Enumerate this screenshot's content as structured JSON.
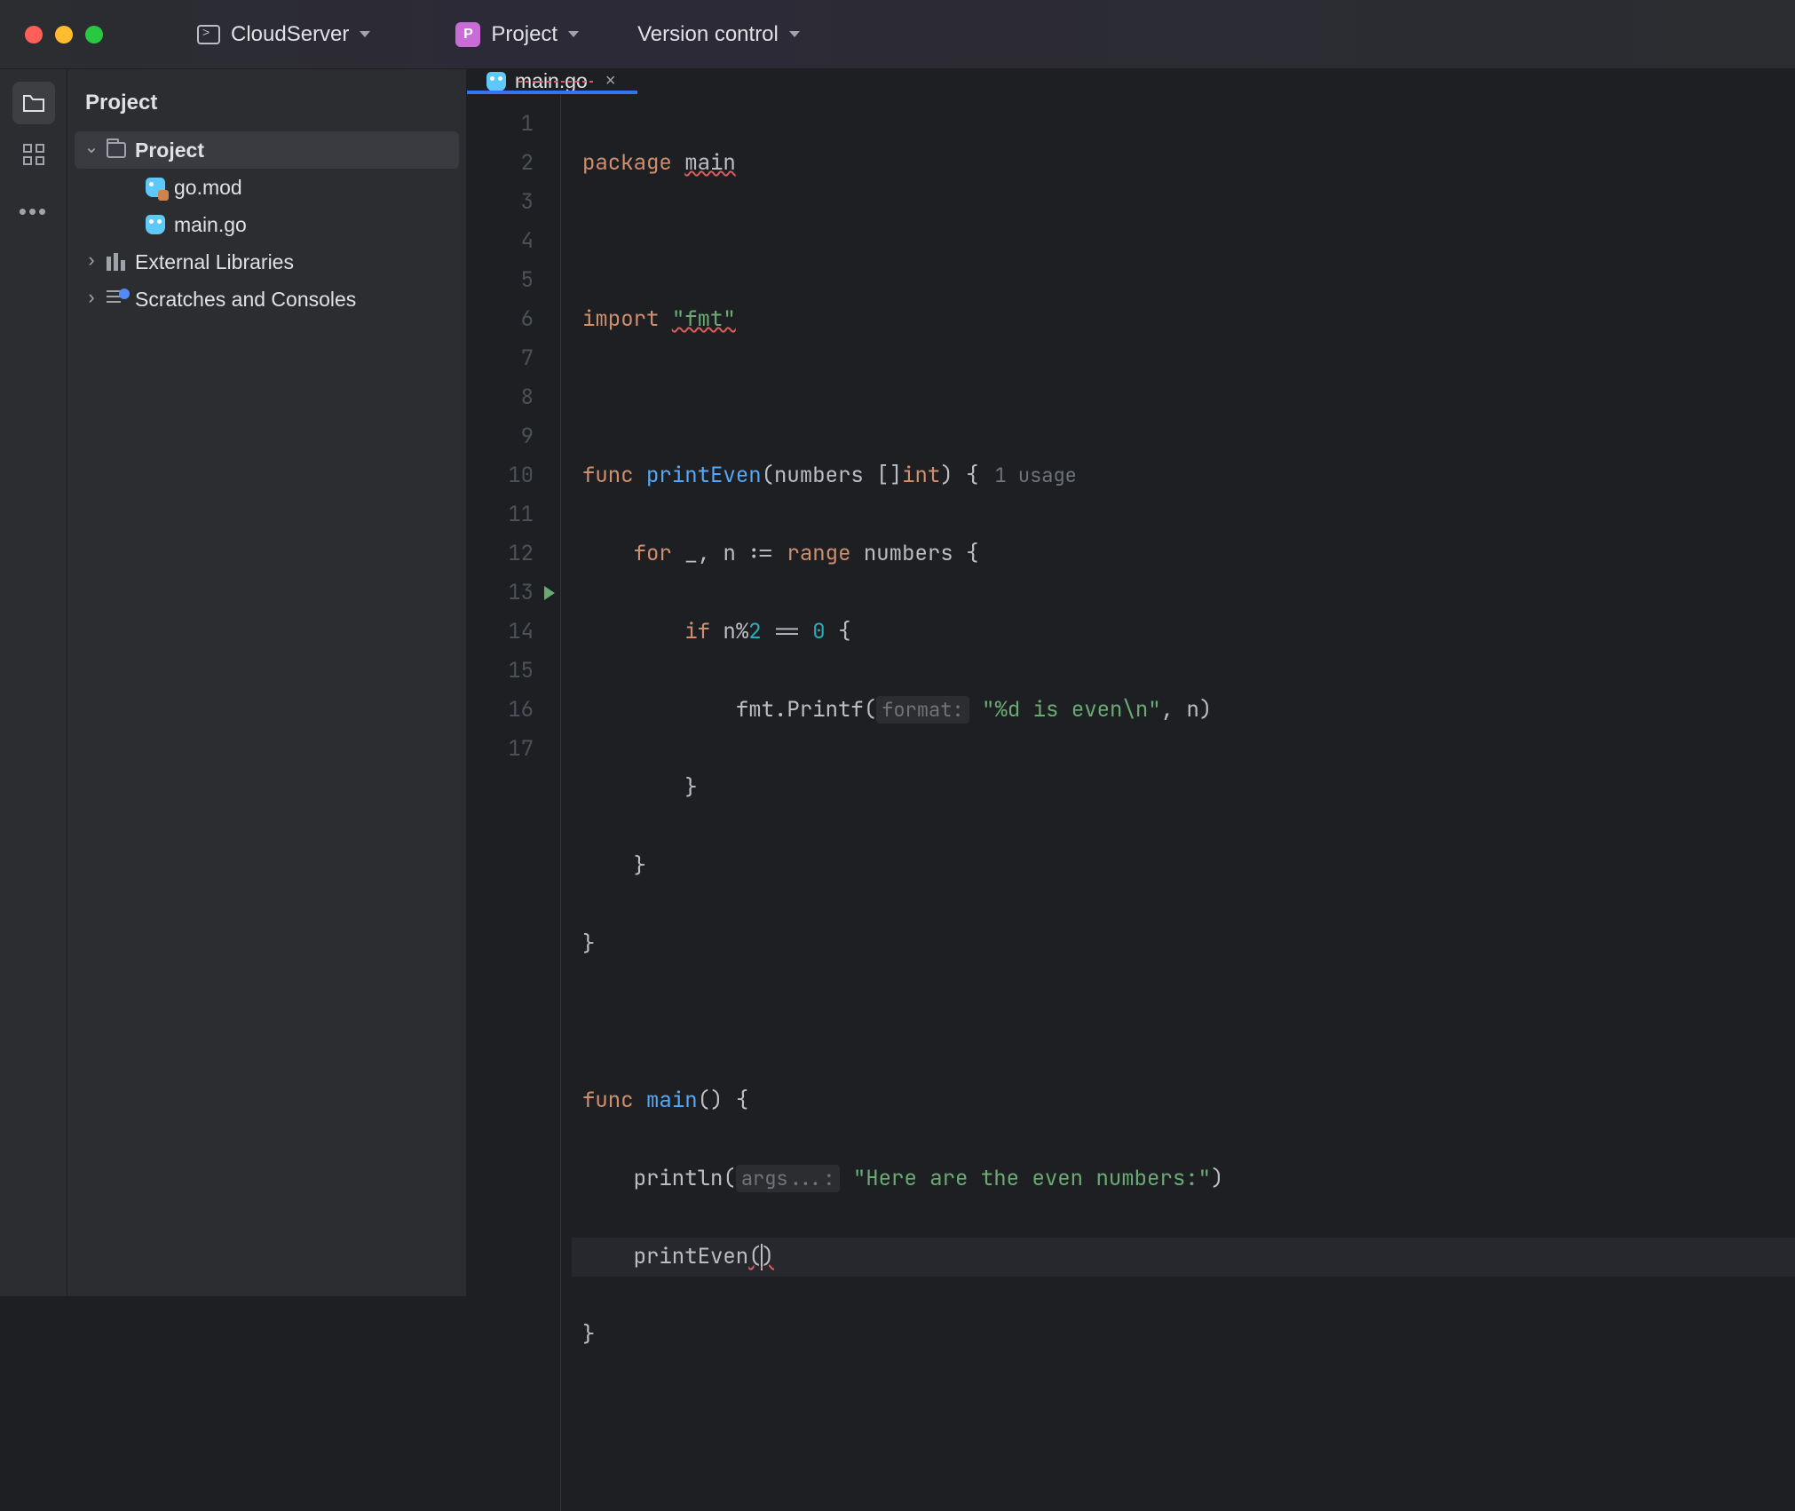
{
  "titlebar": {
    "cloudserver_label": "CloudServer",
    "project_label": "Project",
    "project_badge": "P",
    "vcs_label": "Version control"
  },
  "sidebar": {
    "header": "Project",
    "tree": {
      "root": "Project",
      "files": [
        {
          "name": "go.mod"
        },
        {
          "name": "main.go"
        }
      ],
      "external_libs": "External Libraries",
      "scratches": "Scratches and Consoles"
    }
  },
  "tabs": {
    "active": {
      "filename": "main.go"
    }
  },
  "editor": {
    "line_count": 17,
    "run_line": 13,
    "current_line": 15,
    "code": {
      "l1_kw_package": "package",
      "l1_name": "main",
      "l3_kw_import": "import",
      "l3_str": "\"fmt\"",
      "l5_kw_func": "func",
      "l5_fn": "printEven",
      "l5_param_open": "(",
      "l5_param_name": "numbers",
      "l5_param_type_prefix": "[]",
      "l5_param_type": "int",
      "l5_rest": ") {",
      "l5_usage_hint": "1 usage",
      "l6_kw_for": "for",
      "l6_blank": "_",
      "l6_comma": ",",
      "l6_var": "n",
      "l6_assign": ":=",
      "l6_kw_range": "range",
      "l6_coll": "numbers",
      "l6_brace": "{",
      "l7_kw_if": "if",
      "l7_expr_var": "n",
      "l7_expr_op": "%",
      "l7_expr_num": "2",
      "l7_eq": "==",
      "l7_zero": "0",
      "l7_brace": "{",
      "l8_pkg": "fmt",
      "l8_dot": ".",
      "l8_fn": "Printf",
      "l8_open": "(",
      "l8_hint": "format:",
      "l8_str": "\"%d is even\\n\"",
      "l8_comma": ",",
      "l8_arg": "n",
      "l8_close": ")",
      "l9_close": "}",
      "l10_close": "}",
      "l11_close": "}",
      "l13_kw_func": "func",
      "l13_fn": "main",
      "l13_sig": "() {",
      "l14_fn": "println",
      "l14_open": "(",
      "l14_hint": "args...:",
      "l14_str": "\"Here are the even numbers:\"",
      "l14_close": ")",
      "l15_fn": "printEven",
      "l15_parens_open": "(",
      "l15_parens_close": ")",
      "l16_close": "}"
    }
  }
}
